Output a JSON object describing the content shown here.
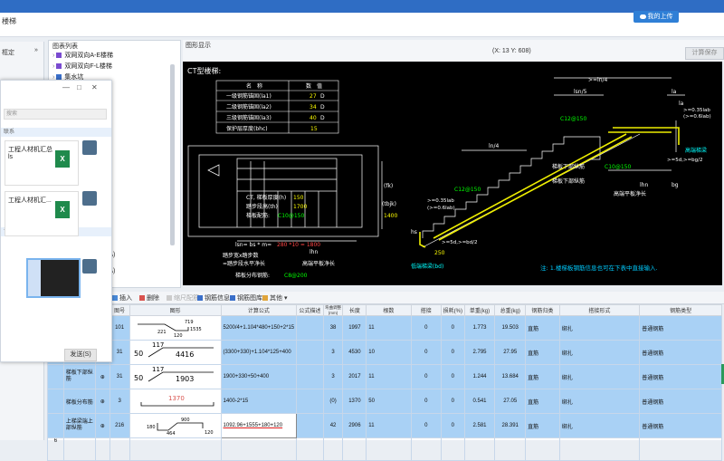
{
  "app": {
    "menu_label": "楼梯"
  },
  "cloud_button": {
    "label": "我的上传"
  },
  "left_panel": {
    "header": "框定",
    "expand": "»"
  },
  "component_list": {
    "title": "图表列表",
    "items": [
      {
        "label": "双网双向A-E楼梯"
      },
      {
        "label": "双网双向F-L楼梯"
      },
      {
        "label": "集水坑"
      }
    ],
    "fragments": [
      "-A)",
      "-A)"
    ]
  },
  "chat": {
    "controls": [
      "—",
      "□",
      "✕"
    ],
    "search_placeholder": "搜索",
    "bands": [
      "联系",
      "详情",
      "更多"
    ],
    "files": [
      {
        "name": "工程人材机汇总",
        "ext": "ls",
        "icon_text": "X"
      },
      {
        "name": "工程人材机汇...",
        "ext": "",
        "icon_text": "X"
      }
    ],
    "send": "发送(S)"
  },
  "drawing": {
    "panel_title": "图形显示",
    "coord": "(X: 13 Y: 608)",
    "calc_save": "计算保存",
    "title": "CT型楼梯:",
    "param_table": {
      "headers": [
        "名　称",
        "数　值"
      ],
      "rows": [
        {
          "name": "一级钢筋锚固(la1)",
          "value": "27",
          "unit": "D"
        },
        {
          "name": "二级钢筋锚固(la2)",
          "value": "34",
          "unit": "D"
        },
        {
          "name": "三级钢筋锚固(la3)",
          "value": "40",
          "unit": "D"
        },
        {
          "name": "保护层厚度(bhc)",
          "value": "15",
          "unit": ""
        }
      ]
    },
    "plan": {
      "t1": "CT, 梯板厚度(h)",
      "t1v": "150",
      "t2": "踏步段高(th)",
      "t2v": "1700",
      "t3": "梯板配筋:",
      "t3v": "C10@150",
      "fk": "(fk)",
      "tbjk": "(tbjk)",
      "tbjk_v": "1400",
      "lsn": "lsn= bs * m=",
      "lsn_v": "280 *10 = 1800",
      "lhn": "lhn",
      "steps": "踏步宽x踏步数",
      "steps2": "=踏步段水平净长",
      "hlen": "高端平板净长",
      "dist": "梯板分布钢筋:",
      "dist_v": "C8@200"
    },
    "section": {
      "ln4a": ">=ln/4",
      "lsn5": "lsn/5",
      "la": "la",
      "la2": "la",
      "lab": ">=0.35lab",
      "lab2": "(>=0.6lab)",
      "top_bar": "C12@150",
      "h_beam": "高端梯梁",
      "h5d": ">=5d,>=bg/2",
      "bottom_long": "梯板下部纵筋",
      "bottom_long_v": "C10@150",
      "ln4b": "ln/4",
      "c12b": "C12@150",
      "bottom_long2": "梯板下部纵筋",
      "hs": "hs",
      "lhn": "lhn",
      "hlen": "高端平板净长",
      "bg": "bg",
      "h": "h",
      "l5d": ">=5d,>=bd/2",
      "bd_v": "250",
      "l_beam": "低端梯梁(bd)",
      "lab_l": ">=0.35lab",
      "lab_l2": "(>=0.6lab)"
    },
    "note": "注: 1.楼梯板钢筋信息也可在下表中直接输入."
  },
  "toolbar": {
    "items": [
      "插入",
      "删除",
      "缩尺配筋",
      "钢筋信息",
      "钢筋图库",
      "其他"
    ]
  },
  "table": {
    "headers": [
      "",
      "级别",
      "图号",
      "图形",
      "计算公式",
      "公式描述",
      "弯曲调整(mm)",
      "长度",
      "根数",
      "搭接",
      "损耗(%)",
      "单重(kg)",
      "总重(kg)",
      "钢筋归类",
      "搭接形式",
      "钢筋类型"
    ],
    "rows": [
      {
        "name": "",
        "grade": "⊕",
        "fig_no": "101",
        "formula": "5200/4+1.104*480+150+2*15",
        "desc": "",
        "adj": "38",
        "len": "1997",
        "count": "11",
        "lap": "0",
        "loss": "0",
        "unit_w": "1.773",
        "total_w": "19.503",
        "cat": "直筋",
        "lap_form": "绑扎",
        "type": "普通钢筋",
        "shape": {
          "a": "719",
          "b": "221",
          "c": "120",
          "d": "1535"
        }
      },
      {
        "name": "",
        "grade": "⊕",
        "fig_no": "31",
        "formula": "(3300+330)+1.104*125+400",
        "desc": "",
        "adj": "3",
        "len": "4530",
        "count": "10",
        "lap": "0",
        "loss": "0",
        "unit_w": "2.795",
        "total_w": "27.95",
        "cat": "直筋",
        "lap_form": "绑扎",
        "type": "普通钢筋",
        "shape": {
          "a": "50",
          "b": "117",
          "c": "4416"
        }
      },
      {
        "name": "梯板下部纵筋",
        "grade": "⊕",
        "fig_no": "31",
        "formula": "1900+330+50+400",
        "desc": "",
        "adj": "3",
        "len": "2017",
        "count": "11",
        "lap": "0",
        "loss": "0",
        "unit_w": "1.244",
        "total_w": "13.684",
        "cat": "直筋",
        "lap_form": "绑扎",
        "type": "普通钢筋",
        "shape": {
          "a": "50",
          "b": "117",
          "c": "1903"
        }
      },
      {
        "name": "梯板分布筋",
        "grade": "⊕",
        "fig_no": "3",
        "formula": "1400-2*15",
        "desc": "",
        "adj": "(0)",
        "len": "1370",
        "count": "50",
        "lap": "0",
        "loss": "0",
        "unit_w": "0.541",
        "total_w": "27.05",
        "cat": "直筋",
        "lap_form": "绑扎",
        "type": "普通钢筋",
        "shape": {
          "a": "1370"
        }
      },
      {
        "name": "上梯梁端上部纵筋",
        "grade": "⊕",
        "fig_no": "216",
        "formula": "1092.96+1555+180+120",
        "desc": "",
        "adj": "42",
        "len": "2906",
        "count": "11",
        "lap": "0",
        "loss": "0",
        "unit_w": "2.581",
        "total_w": "28.391",
        "cat": "直筋",
        "lap_form": "绑扎",
        "type": "普通钢筋",
        "shape": {
          "a": "180",
          "b": "464",
          "c": "900",
          "d": "120"
        }
      }
    ],
    "row_no_last": "6"
  }
}
